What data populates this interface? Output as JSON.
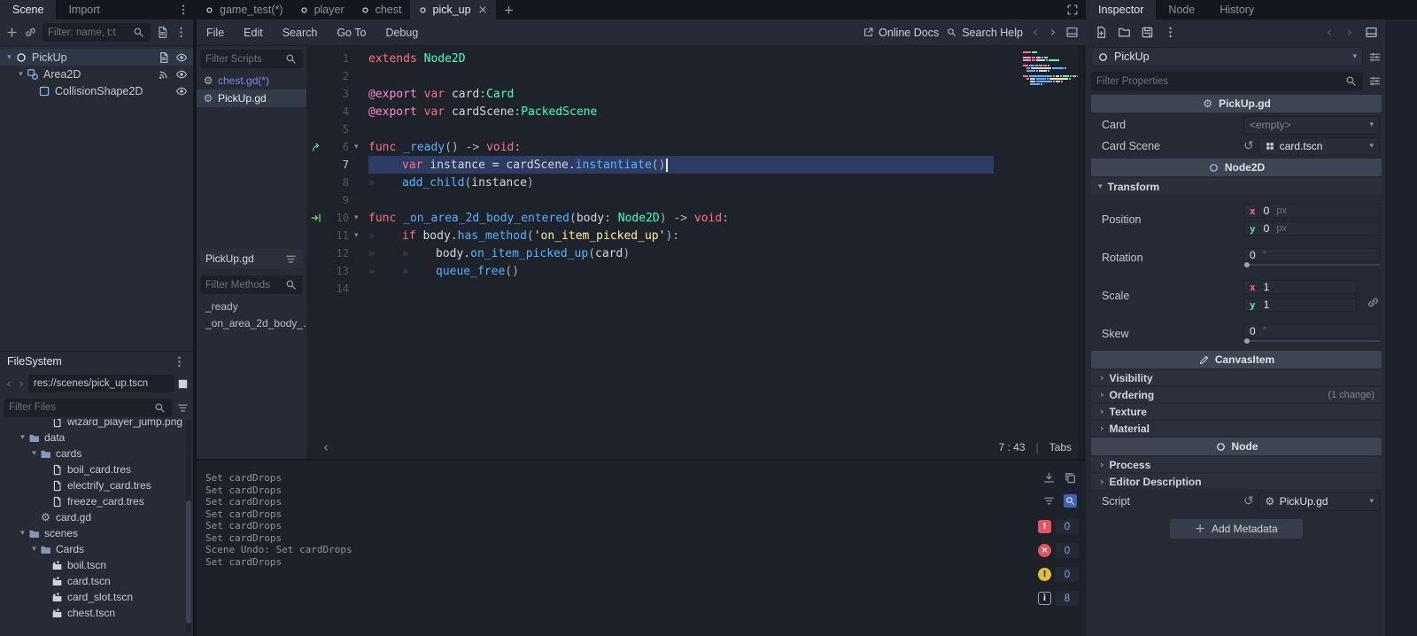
{
  "colors": {
    "accent": "#4f79d0",
    "selection_line": "#2e3c63",
    "error": "#e05561",
    "warning": "#e3bd3f"
  },
  "topbar": {
    "left_tabs": [
      {
        "label": "Scene",
        "active": true
      },
      {
        "label": "Import",
        "active": false
      }
    ],
    "scene_tabs": [
      {
        "label": "game_test(*)",
        "active": false
      },
      {
        "label": "player",
        "active": false
      },
      {
        "label": "chest",
        "active": false
      },
      {
        "label": "pick_up",
        "active": true,
        "closable": true
      }
    ],
    "right_tabs": [
      {
        "label": "Inspector",
        "active": true
      },
      {
        "label": "Node",
        "active": false
      },
      {
        "label": "History",
        "active": false
      }
    ]
  },
  "scene_dock": {
    "filter_placeholder": "Filter: name, t:t",
    "tree": [
      {
        "label": "PickUp",
        "icon": "node-circle",
        "arrow": true,
        "indent": 0,
        "right": [
          "script",
          "eye"
        ],
        "selected": true
      },
      {
        "label": "Area2D",
        "icon": "area2d",
        "arrow": true,
        "indent": 1,
        "right": [
          "signal",
          "eye"
        ]
      },
      {
        "label": "CollisionShape2D",
        "icon": "collision",
        "arrow": false,
        "indent": 2,
        "right": [
          "eye"
        ]
      }
    ]
  },
  "filesystem": {
    "title": "FileSystem",
    "path": "res://scenes/pick_up.tscn",
    "filter_placeholder": "Filter Files",
    "tree": [
      {
        "label": "wizard_player_jump.png",
        "icon": "file",
        "indent": 3,
        "clipped": true
      },
      {
        "label": "data",
        "icon": "folder",
        "arrow": true,
        "indent": 1
      },
      {
        "label": "cards",
        "icon": "folder",
        "arrow": true,
        "indent": 2
      },
      {
        "label": "boil_card.tres",
        "icon": "file",
        "indent": 3
      },
      {
        "label": "electrify_card.tres",
        "icon": "file",
        "indent": 3
      },
      {
        "label": "freeze_card.tres",
        "icon": "file",
        "indent": 3
      },
      {
        "label": "card.gd",
        "icon": "gear",
        "indent": 2
      },
      {
        "label": "scenes",
        "icon": "folder",
        "arrow": true,
        "indent": 1
      },
      {
        "label": "Cards",
        "icon": "folder",
        "arrow": true,
        "indent": 2
      },
      {
        "label": "boil.tscn",
        "icon": "scene",
        "indent": 3
      },
      {
        "label": "card.tscn",
        "icon": "scene",
        "indent": 3
      },
      {
        "label": "card_slot.tscn",
        "icon": "scene",
        "indent": 3
      },
      {
        "label": "chest.tscn",
        "icon": "scene",
        "indent": 3
      }
    ]
  },
  "script_editor": {
    "menus": [
      "File",
      "Edit",
      "Search",
      "Go To",
      "Debug"
    ],
    "online_docs": "Online Docs",
    "search_help": "Search Help",
    "filter_scripts_placeholder": "Filter Scripts",
    "scripts": [
      {
        "label": "chest.gd(*)",
        "modified": true
      },
      {
        "label": "PickUp.gd",
        "selected": true
      }
    ],
    "current_script": "PickUp.gd",
    "filter_methods_placeholder": "Filter Methods",
    "methods": [
      "_ready",
      "_on_area_2d_body_..."
    ],
    "status": {
      "pos": "7 : 43",
      "sep": "|",
      "indent_mode": "Tabs"
    },
    "code": [
      {
        "n": "1",
        "toks": [
          [
            "kw",
            "extends "
          ],
          [
            "type",
            "Node2D"
          ]
        ]
      },
      {
        "n": "2",
        "toks": []
      },
      {
        "n": "3",
        "toks": [
          [
            "ann",
            "@export "
          ],
          [
            "kw",
            "var "
          ],
          [
            "id",
            "card"
          ],
          [
            "op",
            ":"
          ],
          [
            "type",
            "Card"
          ]
        ]
      },
      {
        "n": "4",
        "toks": [
          [
            "ann",
            "@export "
          ],
          [
            "kw",
            "var "
          ],
          [
            "id",
            "cardScene"
          ],
          [
            "op",
            ":"
          ],
          [
            "type",
            "PackedScene"
          ]
        ]
      },
      {
        "n": "5",
        "toks": []
      },
      {
        "n": "6",
        "fold": true,
        "marker": "override",
        "toks": [
          [
            "kw",
            "func "
          ],
          [
            "fn",
            "_ready"
          ],
          [
            "op",
            "() "
          ],
          [
            "op",
            "-> "
          ],
          [
            "kw",
            "void"
          ],
          [
            "op",
            ":"
          ]
        ]
      },
      {
        "n": "7",
        "indent": 1,
        "sel": true,
        "cursor": true,
        "toks": [
          [
            "kw",
            "var "
          ],
          [
            "id",
            "instance = cardScene."
          ],
          [
            "fn",
            "instantiate"
          ],
          [
            "op",
            "()"
          ]
        ]
      },
      {
        "n": "8",
        "indent": 1,
        "toks": [
          [
            "fn",
            "add_child"
          ],
          [
            "op",
            "("
          ],
          [
            "id",
            "instance"
          ],
          [
            "op",
            ")"
          ]
        ]
      },
      {
        "n": "9",
        "toks": []
      },
      {
        "n": "10",
        "fold": true,
        "marker": "connection",
        "toks": [
          [
            "kw",
            "func "
          ],
          [
            "fn",
            "_on_area_2d_body_entered"
          ],
          [
            "op",
            "("
          ],
          [
            "id",
            "body"
          ],
          [
            "op",
            ": "
          ],
          [
            "type",
            "Node2D"
          ],
          [
            "op",
            ") "
          ],
          [
            "op",
            "-> "
          ],
          [
            "kw",
            "void"
          ],
          [
            "op",
            ":"
          ]
        ]
      },
      {
        "n": "11",
        "indent": 1,
        "fold": true,
        "toks": [
          [
            "kw",
            "if "
          ],
          [
            "id",
            "body."
          ],
          [
            "fn",
            "has_method"
          ],
          [
            "op",
            "("
          ],
          [
            "str",
            "'on_item_picked_up'"
          ],
          [
            "op",
            "):"
          ]
        ]
      },
      {
        "n": "12",
        "indent": 2,
        "toks": [
          [
            "id",
            "body."
          ],
          [
            "fn",
            "on_item_picked_up"
          ],
          [
            "op",
            "("
          ],
          [
            "id",
            "card"
          ],
          [
            "op",
            ")"
          ]
        ]
      },
      {
        "n": "13",
        "indent": 2,
        "toks": [
          [
            "fn",
            "queue_free"
          ],
          [
            "op",
            "()"
          ]
        ]
      },
      {
        "n": "14",
        "toks": []
      }
    ]
  },
  "output": {
    "lines": [
      "Set cardDrops",
      "Set cardDrops",
      "Set cardDrops",
      "Set cardDrops",
      "Set cardDrops",
      "Set cardDrops",
      "Scene Undo: Set cardDrops",
      "Set cardDrops"
    ],
    "badges": [
      {
        "name": "errors",
        "cls": "b-sq",
        "glyph": "!",
        "count": "0"
      },
      {
        "name": "errors-x",
        "cls": "b-ci",
        "glyph": "×",
        "count": "0"
      },
      {
        "name": "warnings",
        "cls": "b-wa",
        "glyph": "!",
        "count": "0"
      },
      {
        "name": "monitors",
        "cls": "b-in",
        "glyph": "i",
        "count": "8"
      }
    ]
  },
  "inspector": {
    "node_name": "PickUp",
    "filter_placeholder": "Filter Properties",
    "script_category": "PickUp.gd",
    "card": {
      "label": "Card",
      "value": "<empty>"
    },
    "card_scene": {
      "label": "Card Scene",
      "value": "card.tscn"
    },
    "node2d_category": "Node2D",
    "transform": {
      "label": "Transform",
      "axis_x": "x",
      "axis_y": "y",
      "position": {
        "label": "Position",
        "x": "0",
        "y": "0",
        "unit": "px"
      },
      "rotation": {
        "label": "Rotation",
        "value": "0",
        "unit": "°"
      },
      "scale": {
        "label": "Scale",
        "x": "1",
        "y": "1"
      },
      "skew": {
        "label": "Skew",
        "value": "0",
        "unit": "°"
      }
    },
    "canvasitem_category": "CanvasItem",
    "sections": [
      "Visibility",
      "Ordering",
      "Texture",
      "Material"
    ],
    "ordering_note": "(1 change)",
    "node_category": "Node",
    "node_sections": [
      "Process",
      "Editor Description"
    ],
    "script": {
      "label": "Script",
      "value": "PickUp.gd"
    },
    "add_metadata": "Add Metadata"
  }
}
